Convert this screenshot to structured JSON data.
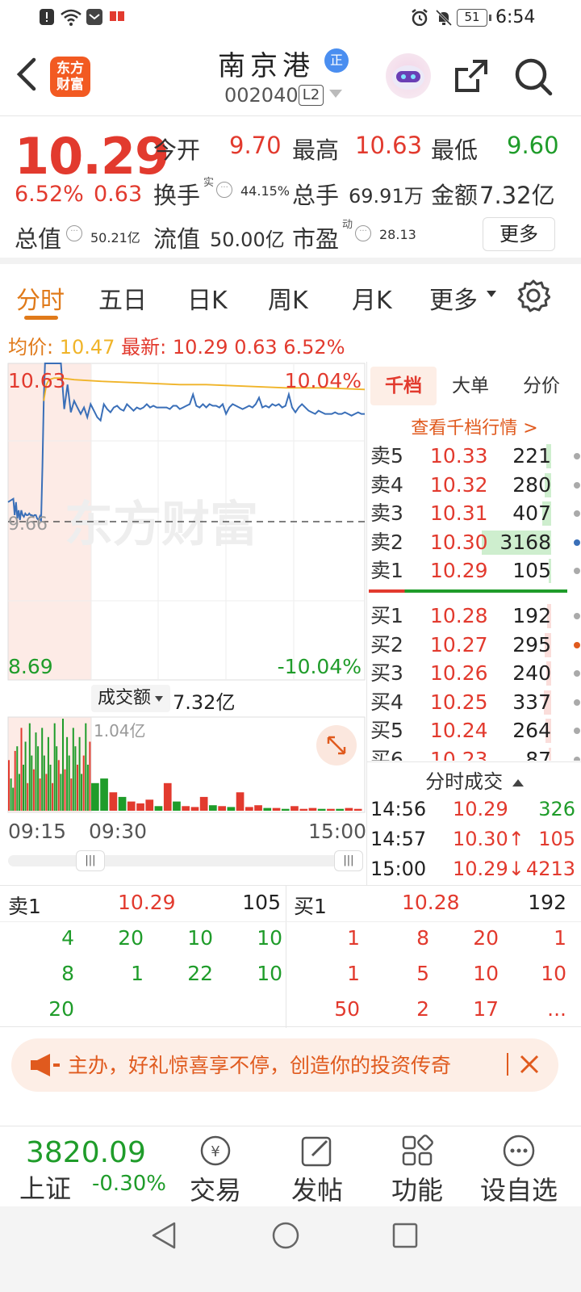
{
  "status_bar": {
    "battery": "51",
    "time": "6:54"
  },
  "header": {
    "logo_text": "东方财富",
    "stock_name": "南京港",
    "stock_badge": "正",
    "stock_code": "002040",
    "level_badge": "L2"
  },
  "quote": {
    "price": "10.29",
    "change_pct": "6.52%",
    "change": "0.63",
    "open_label": "今开",
    "open": "9.70",
    "high_label": "最高",
    "high": "10.63",
    "low_label": "最低",
    "low": "9.60",
    "turnover_label": "换手",
    "turnover_sup": "实",
    "turnover": "44.15%",
    "volume_label": "总手",
    "volume": "69.91万",
    "amount_label": "金额",
    "amount": "7.32亿",
    "mktcap_label": "总值",
    "mktcap": "50.21亿",
    "float_label": "流值",
    "float_cap": "50.00亿",
    "pe_label": "市盈",
    "pe_sup": "动",
    "pe": "28.13",
    "more_button": "更多"
  },
  "tabs": [
    "分时",
    "五日",
    "日K",
    "周K",
    "月K",
    "更多"
  ],
  "infoline": {
    "avg_label": "均价:",
    "avg": "10.47",
    "latest_label": "最新:",
    "latest_price": "10.29",
    "latest_change": "0.63",
    "latest_pct": "6.52%"
  },
  "chart_data": {
    "type": "line",
    "y_labels": {
      "top": "10.63",
      "mid": "9.66",
      "bottom": "8.69",
      "top_pct": "10.04%",
      "bottom_pct": "-10.04%"
    },
    "ylim": [
      8.69,
      10.63
    ],
    "prev_close": 9.66,
    "watermark": "东方财富",
    "x_ticks": [
      "09:15",
      "09:30",
      "15:00"
    ],
    "series": [
      {
        "color": "#3a6fb8",
        "x": [
          0,
          4,
          8,
          10,
          12,
          14,
          16,
          18,
          20,
          22,
          24,
          26,
          28,
          30,
          32,
          34,
          36,
          38,
          40,
          42,
          44,
          46,
          48,
          50,
          52,
          54,
          56,
          58,
          60,
          65,
          70,
          75,
          80,
          85,
          90,
          95,
          100,
          105,
          110,
          115,
          120,
          125,
          130,
          135,
          140,
          145,
          150,
          155,
          160,
          165,
          170,
          175,
          180,
          185,
          190,
          195,
          200,
          205,
          210,
          215,
          220,
          225,
          230,
          235,
          240,
          245,
          250,
          255,
          260,
          265,
          270,
          275,
          280,
          285,
          290,
          295,
          300,
          305,
          310,
          315,
          320,
          325,
          330,
          335,
          340,
          345,
          350,
          355,
          360,
          365,
          370,
          375,
          380,
          385,
          390,
          395,
          400,
          405,
          410,
          415,
          420,
          425,
          430,
          435,
          440,
          445,
          450,
          455,
          460,
          465,
          470,
          475,
          480,
          485,
          490,
          495,
          500,
          505,
          510,
          515,
          520,
          525,
          530,
          535,
          540
        ],
        "values": [
          9.78,
          9.79,
          9.8,
          9.7,
          9.78,
          9.68,
          9.73,
          9.67,
          9.73,
          9.7,
          9.69,
          9.71,
          9.7,
          9.7,
          9.71,
          9.7,
          9.7,
          9.69,
          9.7,
          9.7,
          9.68,
          9.67,
          9.69,
          9.66,
          10.0,
          10.4,
          10.63,
          10.63,
          10.63,
          10.63,
          10.63,
          10.63,
          10.63,
          10.35,
          10.5,
          10.33,
          10.4,
          10.36,
          10.32,
          10.36,
          10.3,
          10.38,
          10.34,
          10.3,
          10.28,
          10.38,
          10.35,
          10.33,
          10.36,
          10.37,
          10.35,
          10.34,
          10.38,
          10.36,
          10.34,
          10.36,
          10.35,
          10.36,
          10.38,
          10.36,
          10.37,
          10.36,
          10.36,
          10.36,
          10.36,
          10.35,
          10.37,
          10.37,
          10.35,
          10.36,
          10.37,
          10.38,
          10.44,
          10.37,
          10.36,
          10.38,
          10.36,
          10.38,
          10.37,
          10.37,
          10.36,
          10.38,
          10.32,
          10.36,
          10.38,
          10.37,
          10.36,
          10.35,
          10.36,
          10.37,
          10.36,
          10.38,
          10.42,
          10.36,
          10.37,
          10.36,
          10.38,
          10.37,
          10.38,
          10.36,
          10.37,
          10.44,
          10.36,
          10.33,
          10.36,
          10.38,
          10.36,
          10.34,
          10.33,
          10.32,
          10.34,
          10.33,
          10.32,
          10.32,
          10.32,
          10.33,
          10.32,
          10.32,
          10.33,
          10.32,
          10.31,
          10.32,
          10.33,
          10.32,
          10.32
        ]
      },
      {
        "color": "#f0b429",
        "x": [
          54,
          58,
          62,
          70,
          80,
          100,
          140,
          200,
          260,
          300,
          360,
          420,
          480,
          540
        ],
        "values": [
          10.4,
          10.5,
          10.53,
          10.54,
          10.54,
          10.53,
          10.52,
          10.51,
          10.5,
          10.5,
          10.49,
          10.48,
          10.48,
          10.47
        ]
      }
    ]
  },
  "volume": {
    "label": "成交额",
    "value": "7.32亿",
    "max_label": "1.04亿",
    "bars": [
      0.55,
      0.35,
      0.25,
      0.65,
      0.7,
      0.4,
      0.9,
      0.5,
      0.75,
      0.3,
      0.95,
      0.6,
      0.45,
      0.85,
      0.7,
      0.35,
      0.9,
      0.6,
      0.4,
      0.8,
      0.5,
      0.3,
      0.95,
      0.7,
      0.55,
      0.4,
      1.0,
      0.45,
      0.8,
      0.6,
      0.35,
      0.9,
      0.7,
      0.5,
      0.8,
      0.4,
      0.6,
      0.95,
      0.5,
      0.75,
      0.3,
      0.35,
      0.2,
      0.15,
      0.1,
      0.08,
      0.12,
      0.05,
      0.3,
      0.1,
      0.05,
      0.04,
      0.15,
      0.06,
      0.05,
      0.04,
      0.2,
      0.04,
      0.06,
      0.03,
      0.03,
      0.02,
      0.05,
      0.02,
      0.03,
      0.02,
      0.02,
      0.02,
      0.03,
      0.02
    ]
  },
  "orderbook": {
    "tabs": [
      "千档",
      "大单",
      "分价"
    ],
    "link": "查看千档行情 >",
    "asks": [
      {
        "label": "卖5",
        "price": "10.33",
        "vol": "221"
      },
      {
        "label": "卖4",
        "price": "10.32",
        "vol": "280"
      },
      {
        "label": "卖3",
        "price": "10.31",
        "vol": "407"
      },
      {
        "label": "卖2",
        "price": "10.30",
        "vol": "3168"
      },
      {
        "label": "卖1",
        "price": "10.29",
        "vol": "105"
      }
    ],
    "bids": [
      {
        "label": "买1",
        "price": "10.28",
        "vol": "192"
      },
      {
        "label": "买2",
        "price": "10.27",
        "vol": "295"
      },
      {
        "label": "买3",
        "price": "10.26",
        "vol": "240"
      },
      {
        "label": "买4",
        "price": "10.25",
        "vol": "337"
      },
      {
        "label": "买5",
        "price": "10.24",
        "vol": "264"
      },
      {
        "label": "买6",
        "price": "10.23",
        "vol": "87"
      }
    ],
    "trades_title": "分时成交",
    "trades": [
      {
        "time": "14:56",
        "price": "10.29",
        "vol": "326"
      },
      {
        "time": "14:57",
        "price": "10.30↑",
        "vol": "105"
      },
      {
        "time": "15:00",
        "price": "10.29↓",
        "vol": "4213"
      }
    ]
  },
  "level1": {
    "ask_label": "卖1",
    "ask_price": "10.29",
    "ask_vol": "105",
    "bid_label": "买1",
    "bid_price": "10.28",
    "bid_vol": "192",
    "ask_queue": [
      [
        "4",
        "20",
        "10",
        "10"
      ],
      [
        "8",
        "1",
        "22",
        "10"
      ],
      [
        "20",
        "",
        "",
        ""
      ]
    ],
    "bid_queue": [
      [
        "1",
        "8",
        "20",
        "1"
      ],
      [
        "1",
        "5",
        "10",
        "10"
      ],
      [
        "50",
        "2",
        "17",
        "..."
      ]
    ]
  },
  "ad": {
    "text": "主办，好礼惊喜享不停，创造你的投资传奇"
  },
  "bottom": {
    "index_value": "3820.09",
    "index_name": "上证",
    "index_change": "-0.30%",
    "buttons": [
      "交易",
      "发帖",
      "功能",
      "设自选"
    ]
  },
  "colors": {
    "up": "#e23a2e",
    "down": "#1f9c2a",
    "accent": "#e07a1a",
    "price_line": "#3a6fb8",
    "avg_line": "#f0b429"
  }
}
